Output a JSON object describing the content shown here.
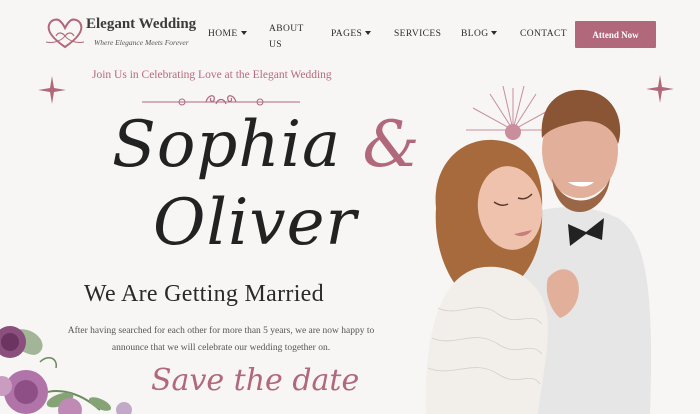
{
  "brand": {
    "title": "Elegant Wedding",
    "tagline": "Where Elegance Meets Forever"
  },
  "nav": {
    "items": [
      {
        "label": "HOME",
        "dropdown": true
      },
      {
        "label": "ABOUT US",
        "dropdown": false
      },
      {
        "label": "PAGES",
        "dropdown": true
      },
      {
        "label": "SERVICES",
        "dropdown": false
      },
      {
        "label": "BLOG",
        "dropdown": true
      },
      {
        "label": "CONTACT",
        "dropdown": false
      }
    ],
    "cta": "Attend Now"
  },
  "hero": {
    "invite": "Join Us in Celebrating Love at the Elegant Wedding",
    "name1": "Sophia",
    "ampersand": "&",
    "name2": "Oliver",
    "subtitle": "We Are Getting Married",
    "description": "After having searched for each other for more than 5 years, we are now happy to announce that we will celebrate our wedding together on.",
    "save_the_date": "Save the date"
  },
  "colors": {
    "accent": "#b0687a",
    "text": "#2b2b2b",
    "background": "#f7f6f5"
  }
}
